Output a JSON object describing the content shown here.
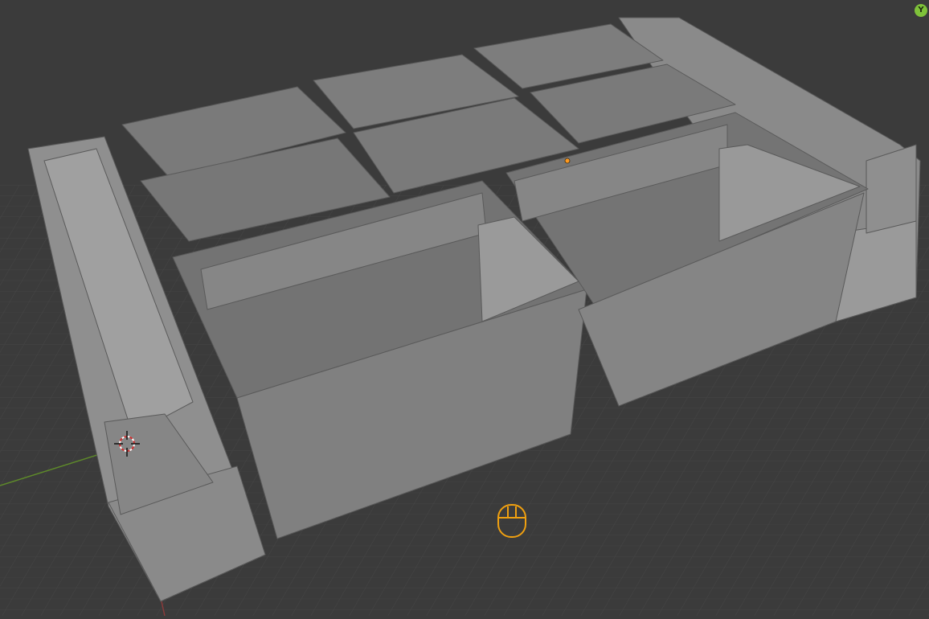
{
  "viewport": {
    "mode": "3D viewport",
    "background_color": "#3b3b3b",
    "grid_color": "#4a4a4a",
    "x_axis_color": "#8a3b3b",
    "y_axis_color": "#5e8a2a",
    "model_color": "#8f8f8f",
    "model_light_color": "#a9a9a9",
    "model_dark_color": "#6c6c6c",
    "edge_color": "#5a5a5a"
  },
  "gizmo": {
    "y_label": "Y",
    "y_color": "#7fc23a"
  },
  "icons": {
    "cursor": "3d-cursor-icon",
    "origin": "object-origin-icon",
    "mouse": "mouse-icon",
    "origin_color": "#ff9a1f",
    "mouse_color": "#f0a010"
  }
}
